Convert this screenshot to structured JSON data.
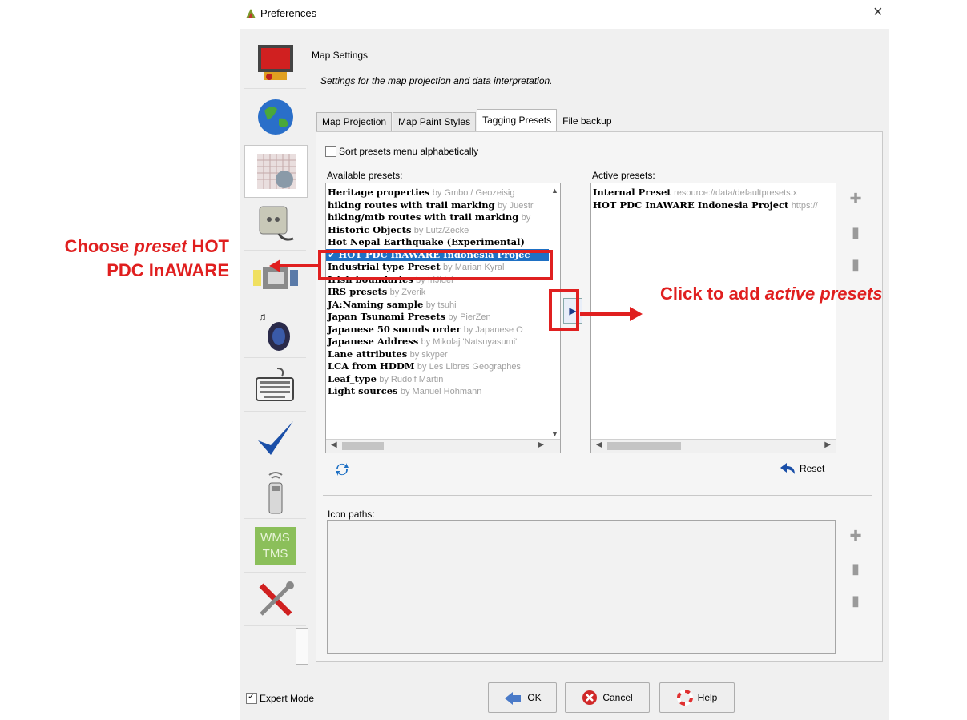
{
  "window": {
    "title": "Preferences",
    "close_glyph": "×"
  },
  "sidebar": {
    "items": [
      {
        "icon": "display-settings-icon"
      },
      {
        "icon": "globe-icon"
      },
      {
        "icon": "map-grid-icon",
        "selected": true
      },
      {
        "icon": "plugin-socket-icon"
      },
      {
        "icon": "presentation-icon"
      },
      {
        "icon": "speaker-icon"
      },
      {
        "icon": "keyboard-icon"
      },
      {
        "icon": "checkmark-icon"
      },
      {
        "icon": "remote-control-icon"
      },
      {
        "icon": "wms-tms-icon",
        "text1": "WMS",
        "text2": "TMS"
      },
      {
        "icon": "tools-icon"
      }
    ]
  },
  "header": {
    "title": "Map Settings",
    "subtitle": "Settings for the map projection and data interpretation."
  },
  "tabs": [
    {
      "label": "Map Projection",
      "active": false
    },
    {
      "label": "Map Paint Styles",
      "active": false
    },
    {
      "label": "Tagging Presets",
      "active": true
    },
    {
      "label": "File backup",
      "active": false
    }
  ],
  "sort_checkbox": {
    "label": "Sort presets menu alphabetically",
    "checked": false
  },
  "available": {
    "label": "Available presets:",
    "items": [
      {
        "name": "Heritage properties",
        "by": "by Gmbo / Geozeisig"
      },
      {
        "name": "hiking routes with trail marking",
        "by": "by Juestr"
      },
      {
        "name": "hiking/mtb routes with trail marking",
        "by": "by"
      },
      {
        "name": "Historic Objects",
        "by": "by Lutz/Zecke"
      },
      {
        "name": "Hot Nepal Earthquake (Experimental)",
        "by": ""
      },
      {
        "name": "HOT PDC InAWARE Indonesia Projec",
        "by": "",
        "selected": true
      },
      {
        "name": "Industrial type Preset",
        "by": "by Marian Kyral"
      },
      {
        "name": "Irish boundaries",
        "by": "by IrlJidel"
      },
      {
        "name": "IRS presets",
        "by": "by Zverik"
      },
      {
        "name": "JA:Naming sample",
        "by": "by tsuhi"
      },
      {
        "name": "Japan Tsunami Presets",
        "by": "by PierZen"
      },
      {
        "name": "Japanese 50 sounds order",
        "by": "by Japanese O"
      },
      {
        "name": "Japanese Address",
        "by": "by Mikolaj 'Natsuyasumi'"
      },
      {
        "name": "Lane attributes",
        "by": "by skyper"
      },
      {
        "name": "LCA from HDDM",
        "by": "by Les Libres Geographes"
      },
      {
        "name": "Leaf_type",
        "by": "by Rudolf Martin"
      },
      {
        "name": "Light sources",
        "by": "by Manuel Hohmann"
      }
    ]
  },
  "active": {
    "label": "Active presets:",
    "items": [
      {
        "name": "Internal Preset",
        "by": "resource://data/defaultpresets.x"
      },
      {
        "name": "HOT PDC InAWARE Indonesia Project",
        "by": "https://"
      }
    ]
  },
  "reset_label": "Reset",
  "icon_paths": {
    "label": "Icon paths:"
  },
  "footer": {
    "expert_mode_label": "Expert Mode",
    "expert_mode_checked": true,
    "ok_label": "OK",
    "cancel_label": "Cancel",
    "help_label": "Help"
  },
  "annotations": {
    "left_line1_a": "Choose ",
    "left_line1_b": "preset",
    "left_line1_c": " HOT",
    "left_line2": "PDC InAWARE",
    "right_a": "Click to add ",
    "right_b": "active presets"
  },
  "colors": {
    "annotation_red": "#e01f1f",
    "selection_blue": "#1e70c4"
  }
}
